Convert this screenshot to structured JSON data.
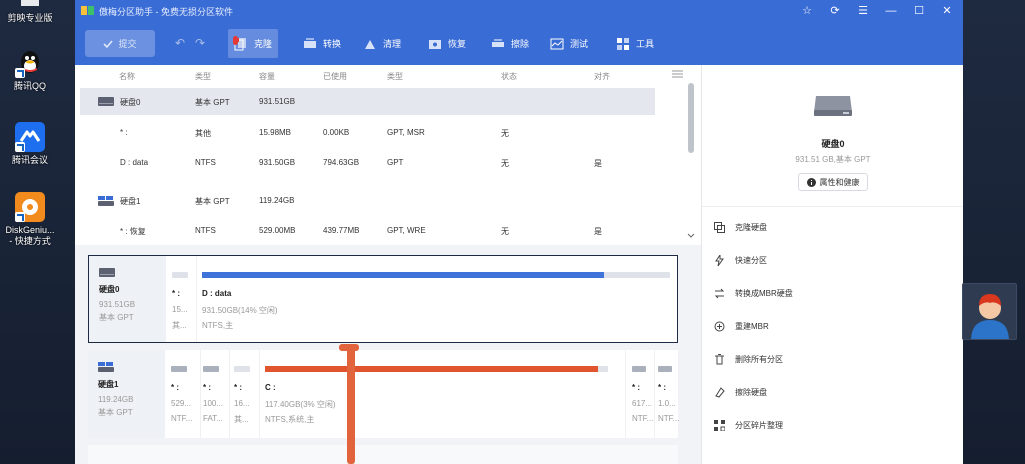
{
  "desktop": {
    "icons": [
      {
        "label": "剪映专业版"
      },
      {
        "label": "腾讯QQ"
      },
      {
        "label": "腾讯会议"
      },
      {
        "label": "DiskGeniu...\n- 快捷方式"
      }
    ]
  },
  "window": {
    "title": "傲梅分区助手 - 免费无损分区软件",
    "controls": {
      "star": "☆",
      "refresh": "⟳",
      "menu": "☰",
      "minimize": "—",
      "maximize": "☐",
      "close": "✕"
    }
  },
  "toolbar": {
    "commit": "提交",
    "undo": "↶",
    "redo": "↷",
    "buttons": [
      {
        "label": "克隆",
        "icon": "clone-icon",
        "active": true
      },
      {
        "label": "转换",
        "icon": "convert-icon"
      },
      {
        "label": "清理",
        "icon": "clean-icon"
      },
      {
        "label": "恢复",
        "icon": "recover-icon"
      },
      {
        "label": "擦除",
        "icon": "wipe-icon"
      },
      {
        "label": "测试",
        "icon": "test-icon"
      },
      {
        "label": "工具",
        "icon": "tools-icon"
      }
    ]
  },
  "table": {
    "headers": {
      "name": "名称",
      "type": "类型",
      "capacity": "容量",
      "used": "已使用",
      "fs": "类型",
      "status": "状态",
      "align": "对齐"
    },
    "rows": [
      {
        "name": "硬盘0",
        "type": "基本 GPT",
        "capacity": "931.51GB",
        "used": "",
        "fs": "",
        "status": "",
        "align": "",
        "is_disk": true
      },
      {
        "name": "* :",
        "type": "其他",
        "capacity": "15.98MB",
        "used": "0.00KB",
        "fs": "GPT, MSR",
        "status": "无",
        "align": ""
      },
      {
        "name": "D : data",
        "type": "NTFS",
        "capacity": "931.50GB",
        "used": "794.63GB",
        "fs": "GPT",
        "status": "无",
        "align": "是"
      },
      {
        "name": "硬盘1",
        "type": "基本 GPT",
        "capacity": "119.24GB",
        "used": "",
        "fs": "",
        "status": "",
        "align": "",
        "is_disk": true
      },
      {
        "name": "* : 恢复",
        "type": "NTFS",
        "capacity": "529.00MB",
        "used": "439.77MB",
        "fs": "GPT, WRE",
        "status": "无",
        "align": "是"
      }
    ]
  },
  "disk_map": {
    "disk0": {
      "name": "硬盘0",
      "size": "931.51GB",
      "type": "基本 GPT",
      "partitions": [
        {
          "name": "* :",
          "size": "15...",
          "fs": "其...",
          "used_fraction": 0.0
        },
        {
          "name": "D : data",
          "size": "931.50GB(14% 空闲)",
          "fs": "NTFS,主",
          "used_fraction": 0.86,
          "color": "#3f73d9"
        }
      ]
    },
    "disk1": {
      "name": "硬盘1",
      "size": "119.24GB",
      "type": "基本 GPT",
      "partitions": [
        {
          "name": "* :",
          "size": "529...",
          "fs": "NTF..."
        },
        {
          "name": "* :",
          "size": "100...",
          "fs": "FAT..."
        },
        {
          "name": "* :",
          "size": "16...",
          "fs": "其..."
        },
        {
          "name": "C :",
          "size": "117.40GB(3% 空闲)",
          "fs": "NTFS,系统,主",
          "used_fraction": 0.97,
          "color": "#e0542e"
        },
        {
          "name": "* :",
          "size": "617...",
          "fs": "NTF..."
        },
        {
          "name": "* :",
          "size": "1.0...",
          "fs": "NTF..."
        }
      ]
    }
  },
  "right_panel": {
    "disk_name": "硬盘0",
    "disk_sub": "931.51 GB,基本 GPT",
    "properties_btn": "属性和健康",
    "actions": [
      {
        "label": "克隆硬盘",
        "icon": "clone-disk-icon"
      },
      {
        "label": "快速分区",
        "icon": "quick-partition-icon"
      },
      {
        "label": "转换成MBR硬盘",
        "icon": "convert-mbr-icon"
      },
      {
        "label": "重建MBR",
        "icon": "rebuild-mbr-icon"
      },
      {
        "label": "删除所有分区",
        "icon": "delete-partitions-icon"
      },
      {
        "label": "擦除硬盘",
        "icon": "wipe-disk-icon"
      },
      {
        "label": "分区碎片整理",
        "icon": "defrag-icon"
      }
    ]
  },
  "colors": {
    "accent": "#3a6cd6",
    "partition_blue": "#3f73d9",
    "partition_orange": "#e0542e",
    "pen": "#e2643c"
  }
}
